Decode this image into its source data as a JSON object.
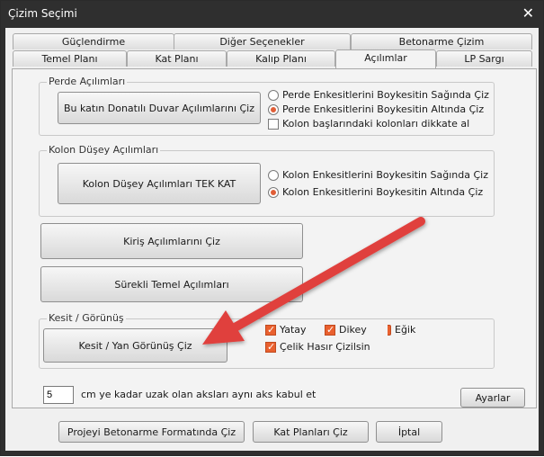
{
  "window": {
    "title": "Çizim Seçimi",
    "close": "✕"
  },
  "tabs_row1": [
    "Güçlendirme",
    "Diğer Seçenekler",
    "Betonarme Çizim"
  ],
  "tabs_row2": [
    "Temel Planı",
    "Kat Planı",
    "Kalıp Planı",
    "Açılımlar",
    "LP Sargı"
  ],
  "perde": {
    "legend": "Perde Açılımları",
    "button": "Bu katın Donatılı Duvar Açılımlarını Çiz",
    "option1": "Perde Enkesitlerini Boykesitin Sağında Çiz",
    "option2": "Perde  Enkesitlerini Boykesitin Altında Çiz",
    "check": "Kolon başlarındaki kolonları dikkate al"
  },
  "kolon": {
    "legend": "Kolon Düşey Açılımları",
    "button": "Kolon Düşey Açılımları TEK KAT",
    "option1": "Kolon Enkesitlerini Boykesitin Sağında Çiz",
    "option2": "Kolon  Enkesitlerini Boykesitin Altında Çiz"
  },
  "kiris_button": "Kiriş Açılımlarını Çiz",
  "surekli_button": "Sürekli Temel Açılımları",
  "kesit": {
    "legend": "Kesit / Görünüş",
    "button": "Kesit / Yan Görünüş Çiz",
    "yatay": "Yatay",
    "dikey": "Dikey",
    "egik": "Eğik",
    "celik": "Çelik Hasır Çizilsin"
  },
  "distance": {
    "value": "5",
    "label": "cm ye kadar uzak olan aksları aynı aks kabul et"
  },
  "ayarlar_button": "Ayarlar",
  "bottom": {
    "proje": "Projeyi Betonarme Formatında Çiz",
    "kat": "Kat Planları Çiz",
    "iptal": "İptal"
  },
  "colors": {
    "accent": "#e9602e",
    "arrow": "#e0413e",
    "titlebar": "#2f2f2f"
  }
}
